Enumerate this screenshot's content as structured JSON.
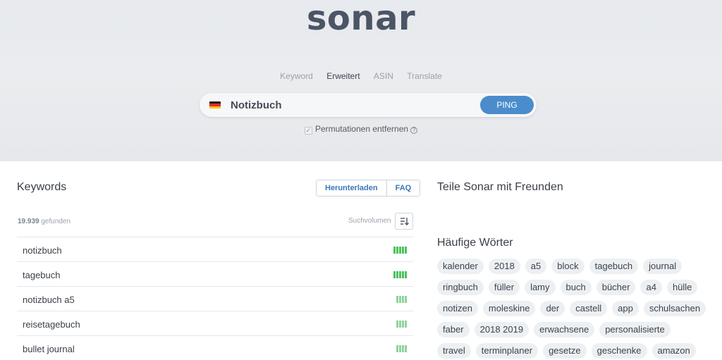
{
  "header": {
    "logo": "sonar",
    "modes": [
      {
        "label": "Keyword",
        "active": false
      },
      {
        "label": "Erweitert",
        "active": true
      },
      {
        "label": "ASIN",
        "active": false
      },
      {
        "label": "Translate",
        "active": false
      }
    ]
  },
  "search": {
    "flag": "germany-flag",
    "value": "Notizbuch",
    "button": "PING",
    "permutations_label": "Permutationen entfernen",
    "permutations_checked": true
  },
  "keywords": {
    "title": "Keywords",
    "download_label": "Herunterladen",
    "faq_label": "FAQ",
    "found_count": "19.939",
    "found_label": "gefunden",
    "volume_label": "Suchvolumen",
    "rows": [
      {
        "keyword": "notizbuch",
        "volume_level": 5
      },
      {
        "keyword": "tagebuch",
        "volume_level": 5
      },
      {
        "keyword": "notizbuch a5",
        "volume_level": 4
      },
      {
        "keyword": "reisetagebuch",
        "volume_level": 4
      },
      {
        "keyword": "bullet journal",
        "volume_level": 4
      }
    ]
  },
  "sidebar": {
    "share_title": "Teile Sonar mit Freunden",
    "frequent_title": "Häufige Wörter",
    "tag_rows": [
      [
        "kalender",
        "2018",
        "a5",
        "block",
        "tagebuch",
        "journal"
      ],
      [
        "ringbuch",
        "füller",
        "lamy",
        "buch",
        "bücher",
        "a4",
        "hülle"
      ],
      [
        "notizen",
        "moleskine",
        "der",
        "castell",
        "app",
        "schulsachen"
      ],
      [
        "faber",
        "2018 2019",
        "erwachsene",
        "personalisierte"
      ],
      [
        "travel",
        "terminplaner",
        "gesetze",
        "geschenke",
        "amazon"
      ]
    ]
  },
  "colors": {
    "accent": "#4a8ccc",
    "bar_strong": "#4cc25f",
    "bar_medium": "#8fd49a",
    "bar_light": "#e3e7eb"
  }
}
